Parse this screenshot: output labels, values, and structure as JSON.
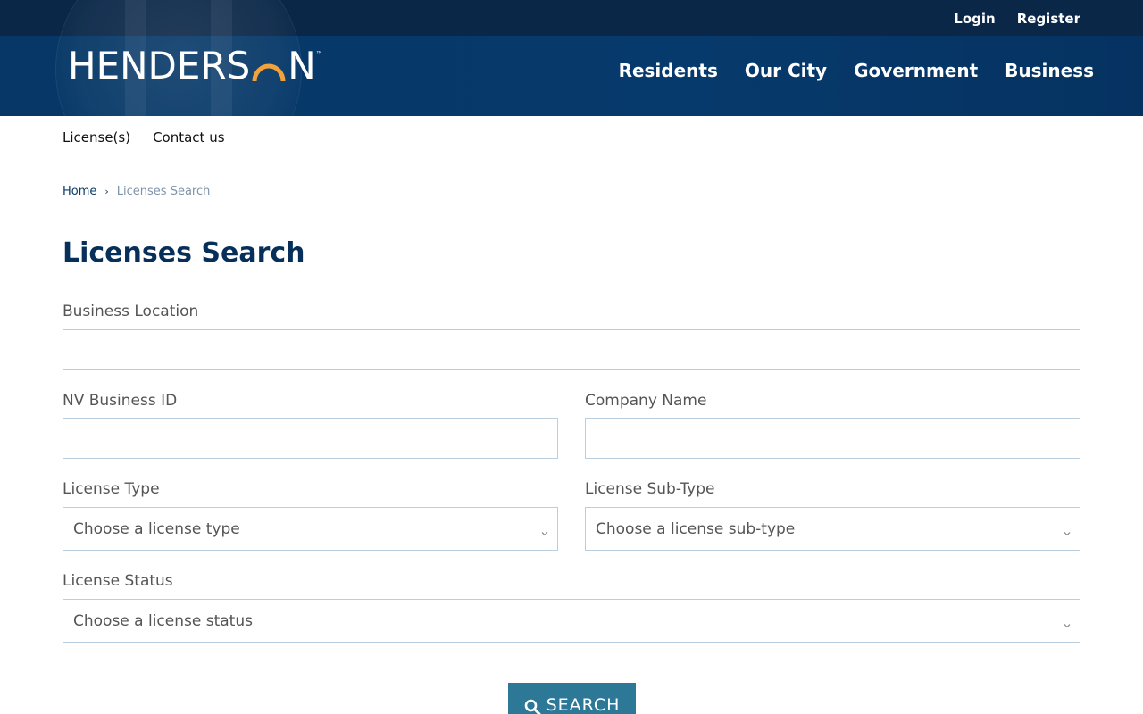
{
  "header": {
    "top_links": {
      "login": "Login",
      "register": "Register"
    },
    "logo": {
      "text_left": "HENDERS",
      "text_right": "N",
      "trademark": "™"
    },
    "nav": [
      "Residents",
      "Our City",
      "Government",
      "Business"
    ]
  },
  "subnav": [
    "License(s)",
    "Contact us"
  ],
  "breadcrumb": {
    "home": "Home",
    "separator": "›",
    "current": "Licenses Search"
  },
  "page": {
    "title": "Licenses Search"
  },
  "form": {
    "business_location": {
      "label": "Business Location",
      "value": ""
    },
    "nv_business_id": {
      "label": "NV Business ID",
      "value": ""
    },
    "company_name": {
      "label": "Company Name",
      "value": ""
    },
    "license_type": {
      "label": "License Type",
      "selected": "Choose a license type"
    },
    "license_subtype": {
      "label": "License Sub-Type",
      "selected": "Choose a license sub-type"
    },
    "license_status": {
      "label": "License Status",
      "selected": "Choose a license status"
    },
    "search_button": {
      "label": "SEARCH",
      "icon": "search-icon"
    }
  },
  "colors": {
    "header_bg": "#063766",
    "topbar_bg": "#0a2748",
    "title_color": "#062f5a",
    "logo_arc": "#f2a23a",
    "button_bg": "#2e7897",
    "field_border": "#b9cfe0"
  }
}
